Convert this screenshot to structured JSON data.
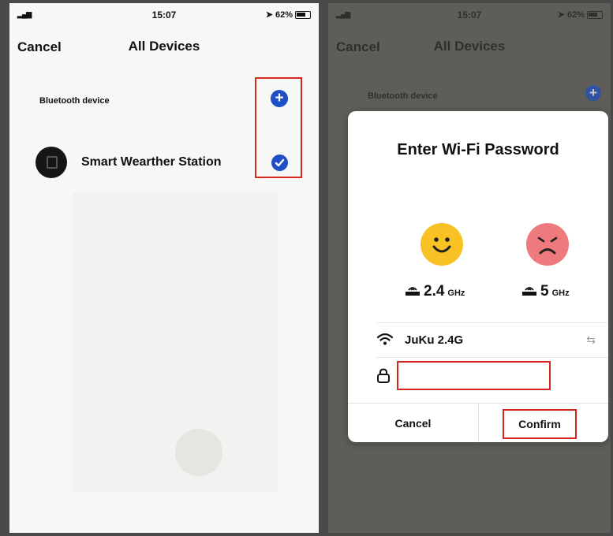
{
  "left_screen": {
    "status_bar": {
      "time": "15:07",
      "battery": "62%"
    },
    "nav": {
      "cancel_label": "Cancel",
      "title": "All Devices"
    },
    "section_label": "Bluetooth device",
    "device": {
      "name": "Smart Wearther Station",
      "selected": true
    },
    "icons": {
      "add": "plus-circle-icon",
      "check": "check-circle-icon"
    },
    "highlight_color": "#d7261f"
  },
  "right_screen": {
    "status_bar": {
      "time": "15:07",
      "battery": "62%"
    },
    "nav": {
      "cancel_label": "Cancel",
      "title": "All Devices"
    },
    "section_label": "Bluetooth device",
    "dialog": {
      "title": "Enter Wi-Fi Password",
      "bands": [
        {
          "freq": "2.4",
          "unit": "GHz",
          "status": "supported",
          "icon": "happy-face-icon"
        },
        {
          "freq": "5",
          "unit": "GHz",
          "status": "unsupported",
          "icon": "sad-face-icon"
        }
      ],
      "ssid": "JuKu 2.4G",
      "password": {
        "value": ""
      },
      "cancel_label": "Cancel",
      "confirm_label": "Confirm"
    },
    "accent_color": "#1f4fc4"
  }
}
